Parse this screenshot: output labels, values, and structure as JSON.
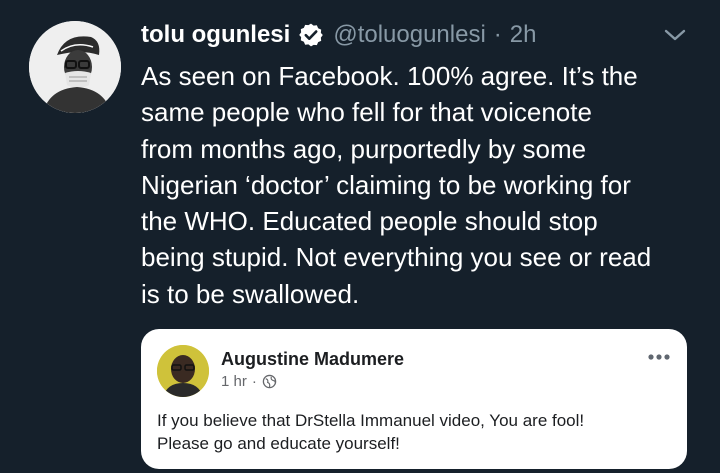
{
  "tweet": {
    "author_name": "tolu ogunlesi",
    "handle": "@toluogunlesi",
    "separator": "·",
    "time": "2h",
    "body_lines": [
      "As seen on Facebook. 100% agree. It’s the",
      "same people who fell for that voicenote",
      "from months ago, purportedly by some",
      "Nigerian ‘doctor’ claiming to be working for",
      "the WHO. Educated people should stop",
      "being stupid. Not everything you see or read",
      "is to be swallowed."
    ]
  },
  "embedded_post": {
    "author_name": "Augustine Madumere",
    "time": "1 hr",
    "separator": "·",
    "text_lines": [
      "If you believe that DrStella Immanuel video, You are fool!",
      "Please go and educate yourself!"
    ]
  },
  "colors": {
    "background": "#15202b",
    "text_primary": "#ffffff",
    "text_secondary": "#8899a6",
    "card_background": "#ffffff"
  },
  "icons": {
    "verified": "verified-badge-icon",
    "menu": "chevron-down-icon",
    "globe": "globe-icon",
    "more": "more-horizontal-icon"
  }
}
